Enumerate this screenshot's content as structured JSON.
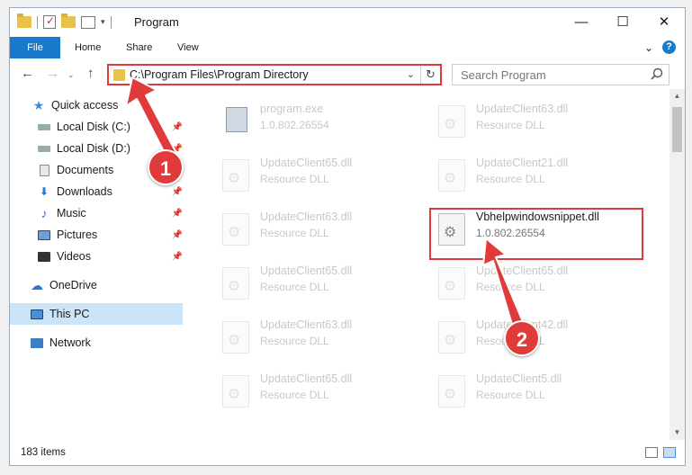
{
  "window": {
    "title": "Program",
    "controls": {
      "minimize": "—",
      "maximize": "☐",
      "close": "✕"
    }
  },
  "ribbon": {
    "tabs": [
      "File",
      "Home",
      "Share",
      "View"
    ],
    "expand_glyph": "⌄",
    "help_glyph": "?"
  },
  "address_bar": {
    "path": "C:\\Program Files\\Program Directory",
    "dropdown_glyph": "⌄",
    "refresh_glyph": "↻"
  },
  "search": {
    "placeholder": "Search Program",
    "icon": "search-icon"
  },
  "nav_glyphs": {
    "back": "←",
    "forward": "→",
    "dropdown": "⌄",
    "up": "↑"
  },
  "sidebar": {
    "pin_glyph": "📌",
    "items": [
      {
        "label": "Quick access",
        "icon": "star-icon"
      },
      {
        "label": "Local Disk (C:)",
        "icon": "drive-icon",
        "pinned": true
      },
      {
        "label": "Local Disk (D:)",
        "icon": "drive-icon",
        "pinned": true
      },
      {
        "label": "Documents",
        "icon": "documents-icon",
        "pinned": true
      },
      {
        "label": "Downloads",
        "icon": "download-icon",
        "pinned": true
      },
      {
        "label": "Music",
        "icon": "music-icon",
        "pinned": true
      },
      {
        "label": "Pictures",
        "icon": "pictures-icon",
        "pinned": true
      },
      {
        "label": "Videos",
        "icon": "videos-icon",
        "pinned": true
      },
      {
        "label": "OneDrive",
        "icon": "cloud-icon"
      },
      {
        "label": "This PC",
        "icon": "computer-icon",
        "selected": true
      },
      {
        "label": "Network",
        "icon": "network-icon"
      }
    ]
  },
  "files": [
    {
      "name": "program.exe",
      "detail": "1.0.802.26554"
    },
    {
      "name": "UpdateClient63.dll",
      "detail": "Resource DLL"
    },
    {
      "name": "UpdateClient65.dll",
      "detail": "Resource DLL"
    },
    {
      "name": "UpdateClient21.dll",
      "detail": "Resource DLL"
    },
    {
      "name": "UpdateClient63.dll",
      "detail": "Resource DLL"
    },
    {
      "name": "Vbhelpwindowsnippet.dll",
      "detail": "1.0.802.26554",
      "highlighted": true
    },
    {
      "name": "UpdateClient65.dll",
      "detail": "Resource DLL"
    },
    {
      "name": "UpdateClient65.dll",
      "detail": "Resource DLL"
    },
    {
      "name": "UpdateClient63.dll",
      "detail": "Resource DLL"
    },
    {
      "name": "UpdateClient42.dll",
      "detail": "Resource DLL"
    },
    {
      "name": "UpdateClient65.dll",
      "detail": "Resource DLL"
    },
    {
      "name": "UpdateClient5.dll",
      "detail": "Resource DLL"
    }
  ],
  "status": {
    "item_count": "183 items"
  },
  "annotations": {
    "step1": "1",
    "step2": "2",
    "color": "#e03a3a"
  }
}
